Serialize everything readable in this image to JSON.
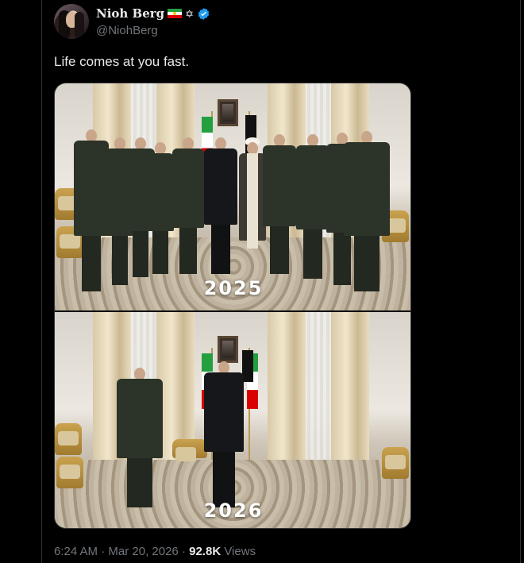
{
  "author": {
    "display_name": "Nioh Berg",
    "handle": "@NiohBerg",
    "badges": [
      "iran-flag-icon",
      "star-of-david-icon",
      "verified-badge-icon"
    ],
    "verified_color": "#1d9bf0"
  },
  "tweet": {
    "text": "Life comes at you fast.",
    "images": [
      {
        "caption": "2025"
      },
      {
        "caption": "2026"
      }
    ]
  },
  "meta": {
    "time": "6:24 AM",
    "separator": "·",
    "date": "Mar 20, 2026",
    "views_count": "92.8K",
    "views_label": "Views"
  },
  "colors": {
    "background": "#000000",
    "text_primary": "#e7e9ea",
    "text_secondary": "#71767b",
    "border": "#2f3336"
  }
}
